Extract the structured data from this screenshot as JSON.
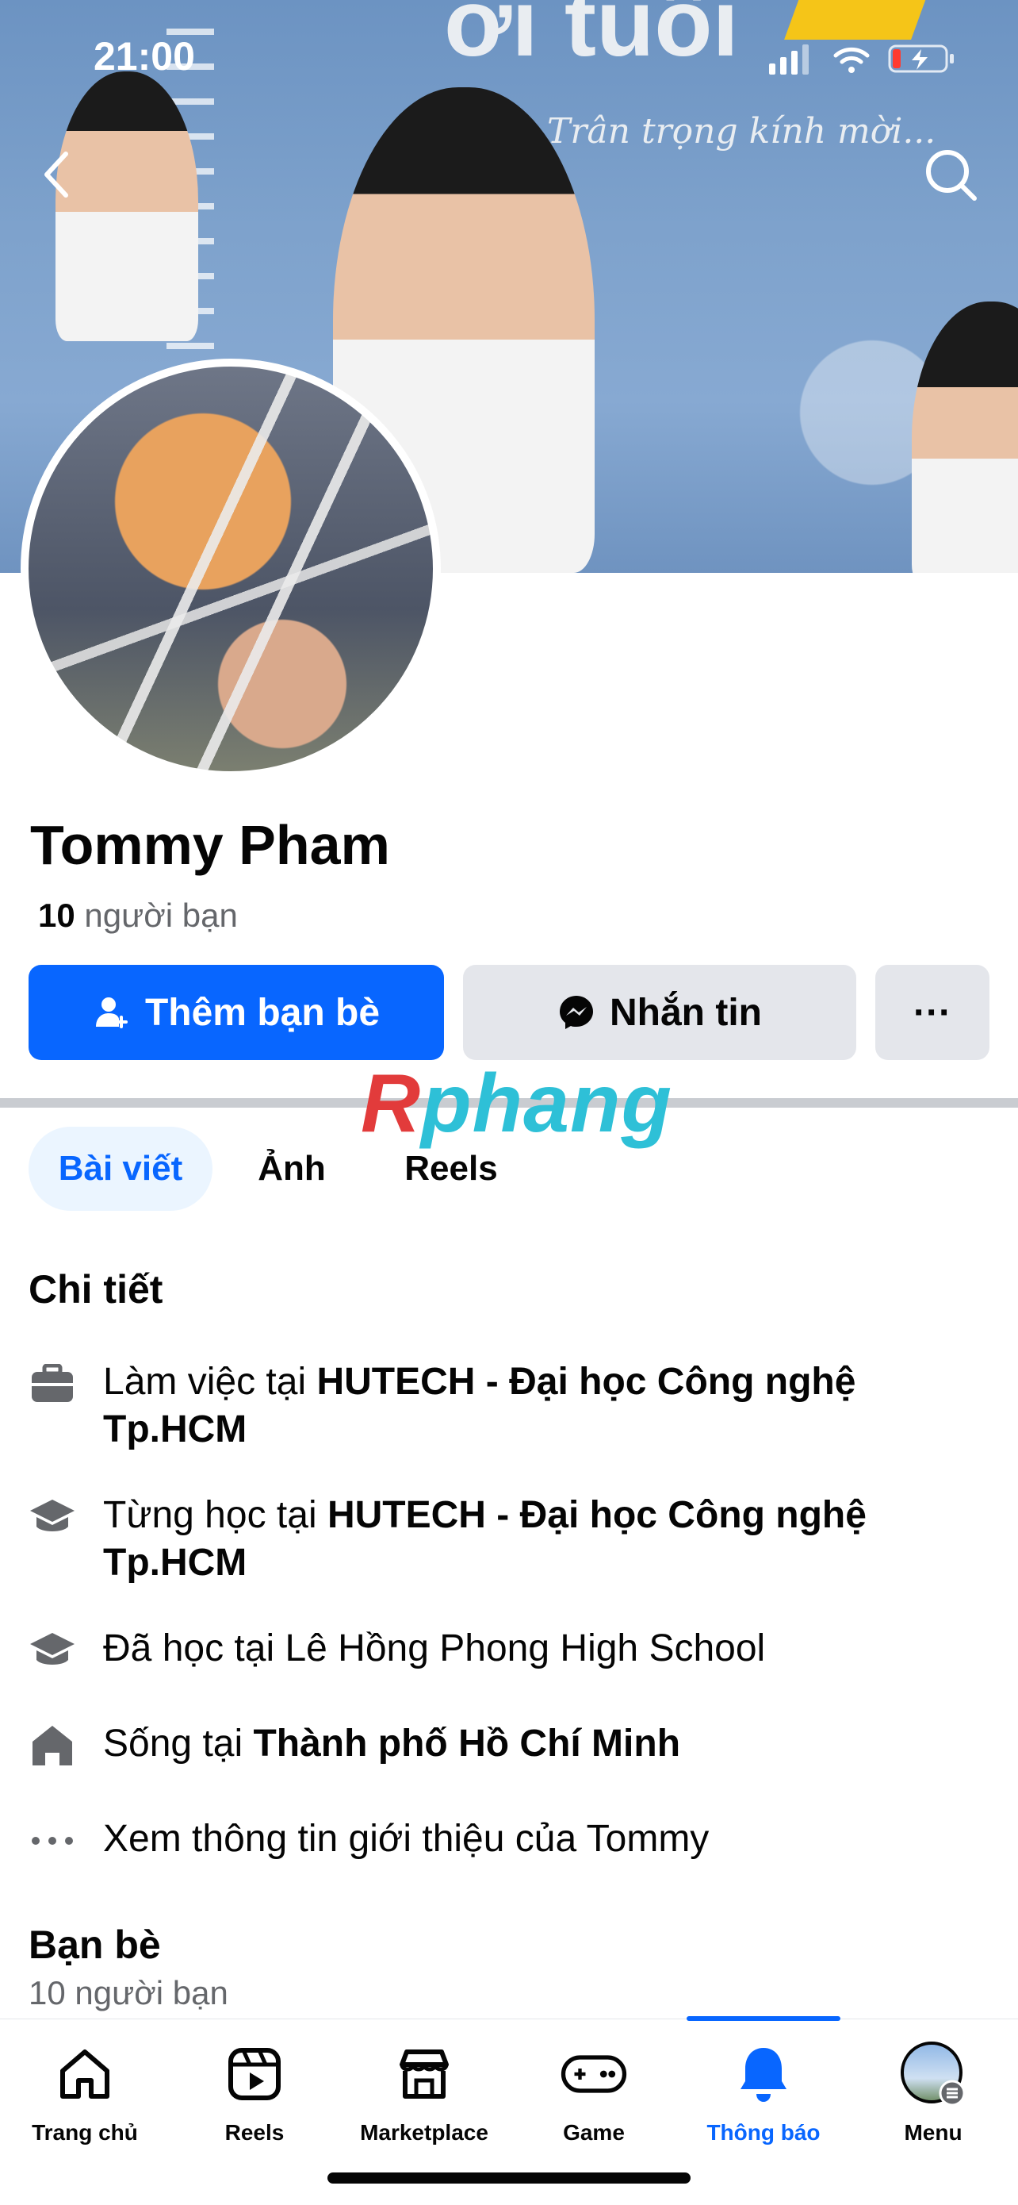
{
  "status_bar": {
    "time": "21:00"
  },
  "cover": {
    "headline": "ơi tuổi",
    "tagline": "Trân trọng kính mời..."
  },
  "profile": {
    "name": "Tommy Pham",
    "friends_number": "10",
    "friends_label": "người bạn"
  },
  "actions": {
    "add_friend": "Thêm bạn bè",
    "message": "Nhắn tin",
    "more": "···"
  },
  "watermark": {
    "r": "R",
    "rest": "phang"
  },
  "tabs": [
    {
      "label": "Bài viết",
      "active": true
    },
    {
      "label": "Ảnh",
      "active": false
    },
    {
      "label": "Reels",
      "active": false
    }
  ],
  "details": {
    "title": "Chi tiết",
    "items": [
      {
        "icon": "briefcase-icon",
        "prefix": "Làm việc tại ",
        "bold": "HUTECH - Đại học Công nghệ Tp.HCM"
      },
      {
        "icon": "graduation-cap-icon",
        "prefix": "Từng học tại ",
        "bold": "HUTECH - Đại học Công nghệ Tp.HCM"
      },
      {
        "icon": "graduation-cap-icon",
        "prefix": "Đã học tại Lê Hồng Phong High School",
        "bold": ""
      },
      {
        "icon": "home-icon",
        "prefix": "Sống tại ",
        "bold": "Thành phố Hồ Chí Minh"
      },
      {
        "icon": "more-dots-icon",
        "prefix": "Xem thông tin giới thiệu của Tommy",
        "bold": ""
      }
    ]
  },
  "friends_section": {
    "title": "Bạn bè",
    "subtitle": "10 người bạn"
  },
  "bottom_nav": [
    {
      "label": "Trang chủ",
      "icon": "home-icon",
      "active": false
    },
    {
      "label": "Reels",
      "icon": "reels-icon",
      "active": false
    },
    {
      "label": "Marketplace",
      "icon": "marketplace-icon",
      "active": false
    },
    {
      "label": "Game",
      "icon": "gamepad-icon",
      "active": false
    },
    {
      "label": "Thông báo",
      "icon": "bell-icon",
      "active": true
    },
    {
      "label": "Menu",
      "icon": "profile-avatar-icon",
      "active": false
    }
  ],
  "colors": {
    "primary": "#0866ff",
    "secondary_button": "#e4e6eb",
    "muted_text": "#65676b",
    "tab_active_bg": "#ebf5ff"
  }
}
